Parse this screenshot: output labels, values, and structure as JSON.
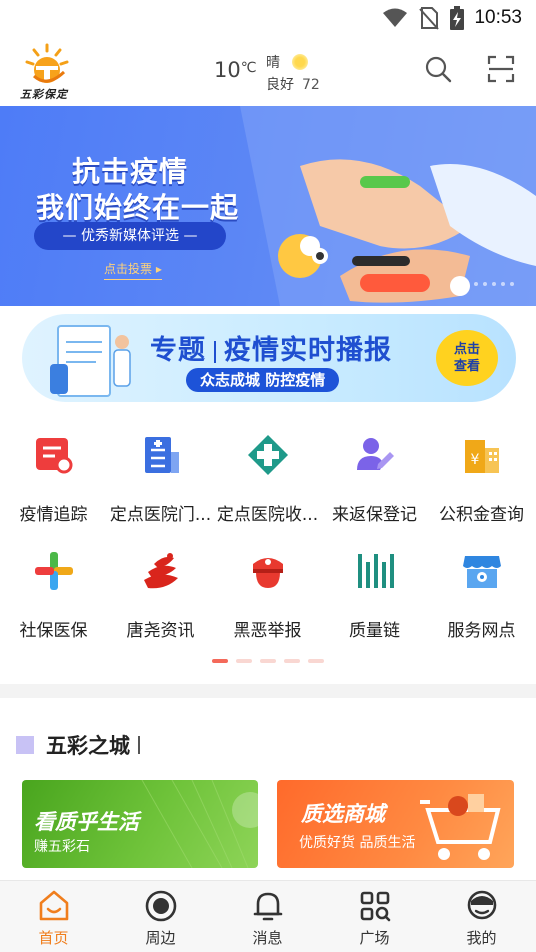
{
  "status_bar": {
    "time": "10:53"
  },
  "header": {
    "logo_text": "五彩保定",
    "temperature": "10",
    "temperature_unit": "℃",
    "condition": "晴",
    "air_quality_label": "良好",
    "air_quality_value": "72"
  },
  "banner": {
    "title_line1": "抗击疫情",
    "title_line2": "我们始终在一起",
    "subtitle": "— 优秀新媒体评选 —",
    "cta": "点击投票"
  },
  "topic": {
    "title_left": "专题",
    "title_right": "疫情实时播报",
    "subtitle": "众志成城  防控疫情",
    "button_line1": "点击",
    "button_line2": "查看"
  },
  "grid_items": [
    {
      "label": "疫情追踪",
      "icon": "epidemic-tracking-icon",
      "color": "#ee3d3d"
    },
    {
      "label": "定点医院门...",
      "icon": "hospital-outpatient-icon",
      "color": "#3b6fe0"
    },
    {
      "label": "定点医院收...",
      "icon": "hospital-admission-icon",
      "color": "#1f9a8a"
    },
    {
      "label": "来返保登记",
      "icon": "return-registration-icon",
      "color": "#7b63e8"
    },
    {
      "label": "公积金查询",
      "icon": "housing-fund-icon",
      "color": "#f0a818"
    },
    {
      "label": "社保医保",
      "icon": "social-insurance-icon",
      "color": "#3aa6f0"
    },
    {
      "label": "唐尧资讯",
      "icon": "tangyao-news-icon",
      "color": "#d9251c"
    },
    {
      "label": "黑恶举报",
      "icon": "crime-report-icon",
      "color": "#e8392f"
    },
    {
      "label": "质量链",
      "icon": "quality-chain-icon",
      "color": "#1f8f80"
    },
    {
      "label": "服务网点",
      "icon": "service-outlet-icon",
      "color": "#2f86e0"
    }
  ],
  "mall": {
    "title": "五彩之城",
    "cards": [
      {
        "title": "看质乎生活",
        "subtitle": "赚五彩石"
      },
      {
        "title": "质选商城",
        "subtitle": "优质好货 品质生活"
      }
    ]
  },
  "tabs": [
    {
      "label": "首页",
      "icon": "home-icon",
      "active": true
    },
    {
      "label": "周边",
      "icon": "nearby-icon",
      "active": false
    },
    {
      "label": "消息",
      "icon": "bell-icon",
      "active": false
    },
    {
      "label": "广场",
      "icon": "square-grid-icon",
      "active": false
    },
    {
      "label": "我的",
      "icon": "profile-icon",
      "active": false
    }
  ],
  "colors": {
    "accent": "#f07e1d",
    "banner_blue": "#4e7cf7",
    "topic_blue": "#1f4fd0"
  }
}
